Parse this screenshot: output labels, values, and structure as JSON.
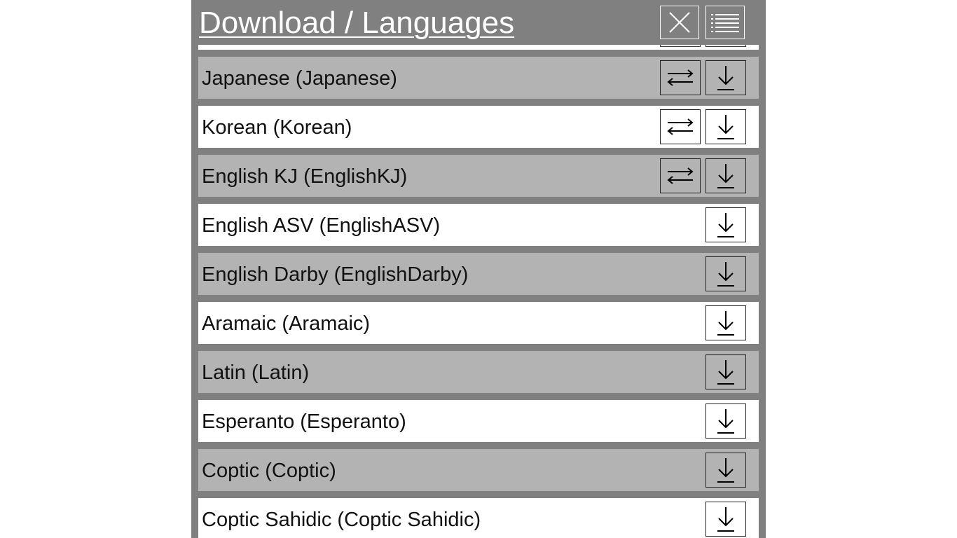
{
  "header": {
    "title": "Download / Languages",
    "close_icon": "close-icon",
    "menu_icon": "list-icon"
  },
  "languages": [
    {
      "label": "Japanese (Japanese)",
      "has_swap": true
    },
    {
      "label": "Korean (Korean)",
      "has_swap": true
    },
    {
      "label": "English KJ (EnglishKJ)",
      "has_swap": true
    },
    {
      "label": "English ASV (EnglishASV)",
      "has_swap": false
    },
    {
      "label": "English Darby (EnglishDarby)",
      "has_swap": false
    },
    {
      "label": "Aramaic (Aramaic)",
      "has_swap": false
    },
    {
      "label": "Latin (Latin)",
      "has_swap": false
    },
    {
      "label": "Esperanto (Esperanto)",
      "has_swap": false
    },
    {
      "label": "Coptic (Coptic)",
      "has_swap": false
    },
    {
      "label": "Coptic Sahidic (Coptic Sahidic)",
      "has_swap": false
    }
  ],
  "icons": {
    "swap": "swap-arrows-icon",
    "download": "download-icon"
  },
  "colors": {
    "panel": "#808080",
    "row_alt": "#b3b3b3",
    "row": "#ffffff"
  }
}
